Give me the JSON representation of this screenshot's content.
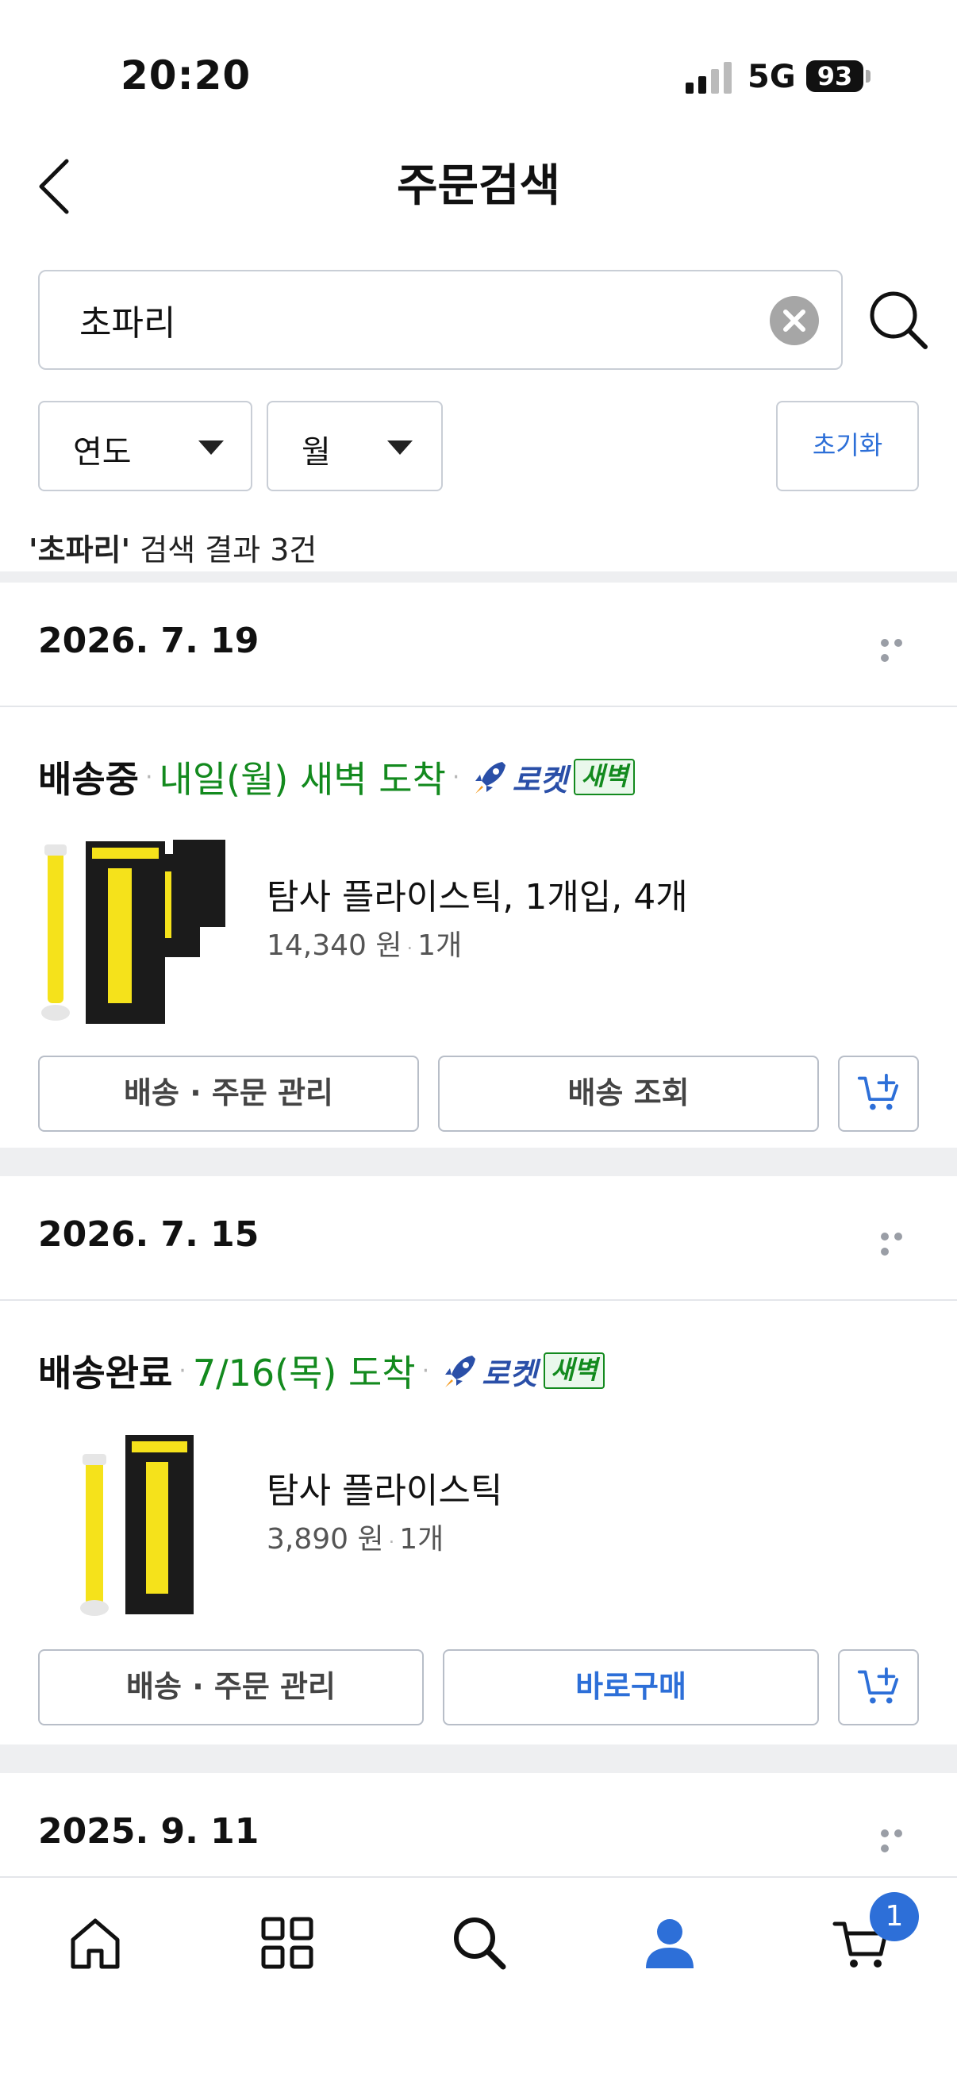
{
  "status_bar": {
    "time": "20:20",
    "network": "5G",
    "battery": "93"
  },
  "header": {
    "title": "주문검색"
  },
  "search": {
    "value": "초파리",
    "placeholder": ""
  },
  "filters": {
    "year_label": "연도",
    "month_label": "월",
    "reset_label": "초기화"
  },
  "results": {
    "keyword": "'초파리'",
    "summary": " 검색 결과 3건"
  },
  "orders": [
    {
      "date": "2026. 7. 19",
      "status": "배송중",
      "eta": "내일(월) 새벽 도착",
      "rocket_label": "로켓",
      "dawn_label": "새벽",
      "product_name": "탐사 플라이스틱, 1개입, 4개",
      "price": "14,340 원",
      "quantity": "1개",
      "buttons": [
        "배송 · 주문 관리",
        "배송 조회"
      ]
    },
    {
      "date": "2026. 7. 15",
      "status": "배송완료",
      "eta": "7/16(목) 도착",
      "rocket_label": "로켓",
      "dawn_label": "새벽",
      "product_name": "탐사 플라이스틱",
      "price": "3,890 원",
      "quantity": "1개",
      "buttons": [
        "배송 · 주문 관리",
        "바로구매"
      ]
    },
    {
      "date": "2025. 9. 11"
    }
  ],
  "bottom_nav": {
    "cart_count": "1",
    "active": "my-page"
  },
  "colors": {
    "accent": "#2d6fd8",
    "eta_green": "#138a1e",
    "rocket_blue": "#2a4fa8"
  }
}
